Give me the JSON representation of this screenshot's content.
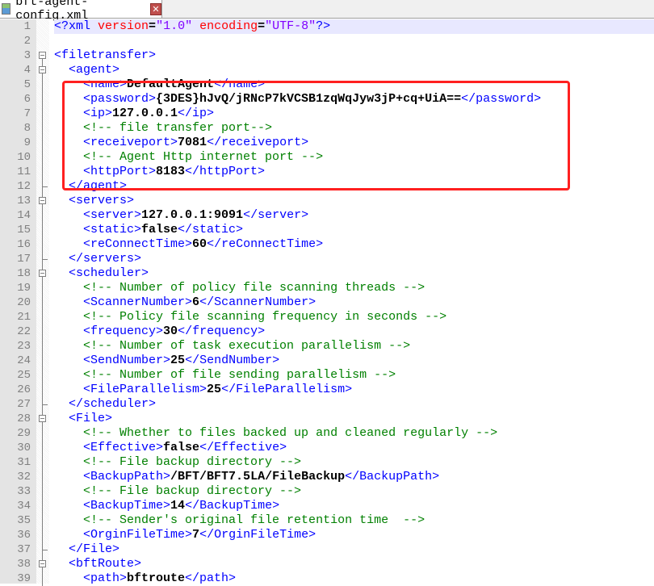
{
  "tab": {
    "title": "bft-agent-config.xml",
    "close_icon": "close-icon"
  },
  "highlight_color": "#ff2020",
  "current_line": 1,
  "fold_open_lines": [
    3,
    4,
    13,
    18,
    28,
    38
  ],
  "fold_end_lines": [
    12,
    17,
    27,
    37
  ],
  "lines": [
    "<?xml version=\"1.0\" encoding=\"UTF-8\"?>",
    "",
    "<filetransfer>",
    "  <agent>",
    "    <name>DefaultAgent</name>",
    "    <password>{3DES}hJvQ/jRNcP7kVCSB1zqWqJyw3jP+cq+UiA==</password>",
    "    <ip>127.0.0.1</ip>",
    "    <!-- file transfer port-->",
    "    <receiveport>7081</receiveport>",
    "    <!-- Agent Http internet port -->",
    "    <httpPort>8183</httpPort>",
    "  </agent>",
    "  <servers>",
    "    <server>127.0.0.1:9091</server>",
    "    <static>false</static>",
    "    <reConnectTime>60</reConnectTime>",
    "  </servers>",
    "  <scheduler>",
    "    <!-- Number of policy file scanning threads -->",
    "    <ScannerNumber>6</ScannerNumber>",
    "    <!-- Policy file scanning frequency in seconds -->",
    "    <frequency>30</frequency>",
    "    <!-- Number of task execution parallelism -->",
    "    <SendNumber>25</SendNumber>",
    "    <!-- Number of file sending parallelism -->",
    "    <FileParallelism>25</FileParallelism>",
    "  </scheduler>",
    "  <File>",
    "    <!-- Whether to files backed up and cleaned regularly -->",
    "    <Effective>false</Effective>",
    "    <!-- File backup directory -->",
    "    <BackupPath>/BFT/BFT7.5LA/FileBackup</BackupPath>",
    "    <!-- File backup directory -->",
    "    <BackupTime>14</BackupTime>",
    "    <!-- Sender's original file retention time  -->",
    "    <OrginFileTime>7</OrginFileTime>",
    "  </File>",
    "  <bftRoute>",
    "    <path>bftroute</path>"
  ]
}
